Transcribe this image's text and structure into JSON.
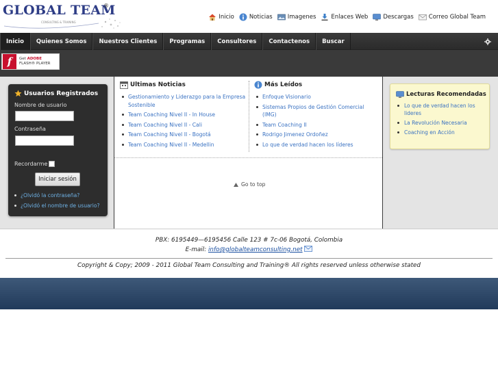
{
  "header": {
    "logo_text": "GLOBAL TEAM",
    "logo_reg": "®",
    "logo_sub": "CONSULTING & TRAINING",
    "toplinks": [
      {
        "label": "Inicio",
        "icon": "home-icon"
      },
      {
        "label": "Noticias",
        "icon": "info-icon"
      },
      {
        "label": "Imagenes",
        "icon": "image-icon"
      },
      {
        "label": "Enlaces Web",
        "icon": "download-arrow-icon"
      },
      {
        "label": "Descargas",
        "icon": "monitor-icon"
      },
      {
        "label": "Correo Global Team",
        "icon": "mail-icon"
      }
    ]
  },
  "nav": {
    "items": [
      "Inicio",
      "Quienes Somos",
      "Nuestros Clientes",
      "Programas",
      "Consultores",
      "Contactenos",
      "Buscar"
    ],
    "active": "Inicio"
  },
  "flash": {
    "line1_prefix": "Get",
    "line1_brand": "ADOBE",
    "line2": "FLASH® PLAYER"
  },
  "login": {
    "title": "Usuarios Registrados",
    "username_label": "Nombre de usuario",
    "password_label": "Contraseña",
    "remember_label": "Recordarme",
    "submit": "Iniciar sesión",
    "links": [
      "¿Olvidó la contraseña?",
      "¿Olvidó el nombre de usuario?"
    ]
  },
  "news": {
    "title": "Ultimas Noticias",
    "items": [
      "Gestionamiento y Liderazgo para la Empresa Sostenible",
      "Team Coaching Nivel II - In House",
      "Team Coaching Nivel II - Cali",
      "Team Coaching Nivel II - Bogotá",
      "Team Coaching Nivel II - Medellin"
    ]
  },
  "most_read": {
    "title": "Más Leídos",
    "items": [
      "Enfoque Visionario",
      "Sistemas Propios de Gestión Comercial (IMG)",
      "Team Coaching II",
      "Rodrigo Jimenez Ordoñez",
      "Lo que de verdad hacen los líderes"
    ]
  },
  "goto_top": "Go to top",
  "readings": {
    "title": "Lecturas Recomendadas",
    "items": [
      "Lo que de verdad hacen los lideres",
      "La Revolución Necesaria",
      "Coaching en Acción"
    ]
  },
  "footer": {
    "contact_line": "PBX: 6195449—6195456   Calle 123 # 7c-06   Bogotá, Colombia",
    "email_prefix": "E-mail: ",
    "email": "info@globalteamconsulting.net",
    "copyright": "Copyright & Copy; 2009 - 2011 Global Team Consulting and Training® All rights reserved unless otherwise stated"
  },
  "colors": {
    "brand": "#2e3d86",
    "nav_bg": "#333333",
    "link": "#3a72c2",
    "reading_bg": "#fbf8cf",
    "bottom_band": "#2b4565"
  }
}
